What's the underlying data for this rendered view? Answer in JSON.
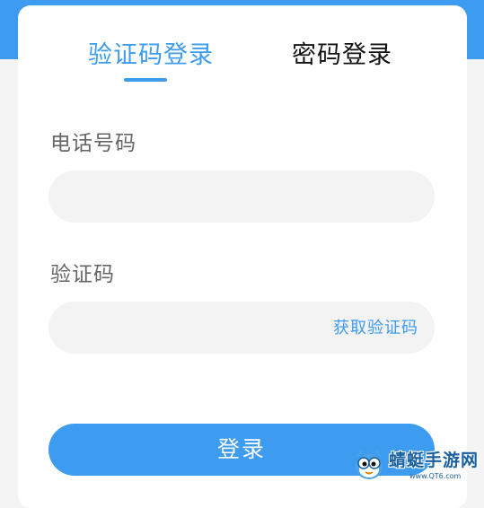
{
  "tabs": {
    "sms_login": "验证码登录",
    "password_login": "密码登录"
  },
  "form": {
    "phone_label": "电话号码",
    "phone_value": "",
    "code_label": "验证码",
    "code_value": "",
    "get_code_label": "获取验证码",
    "login_label": "登录"
  },
  "watermark": {
    "site_name": "蜻蜓手游网",
    "site_url": "www.QT6.com"
  },
  "colors": {
    "accent": "#3d9bf0",
    "input_bg": "#f3f3f3",
    "label_text": "#666666"
  }
}
